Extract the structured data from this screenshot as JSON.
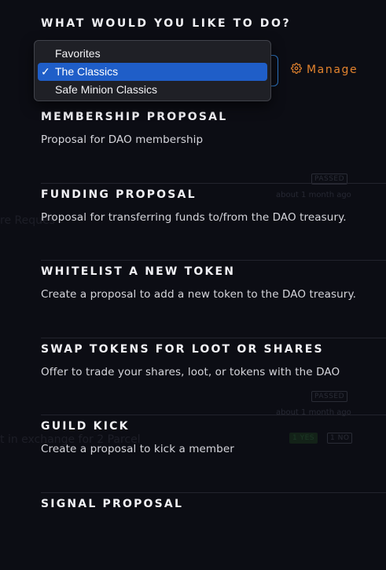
{
  "modal": {
    "heading": "WHAT WOULD YOU LIKE TO DO?",
    "manage_label": "Manage"
  },
  "dropdown": {
    "options": [
      {
        "label": "Favorites",
        "selected": false
      },
      {
        "label": "The Classics",
        "selected": true
      },
      {
        "label": "Safe Minion Classics",
        "selected": false
      }
    ],
    "check_glyph": "✓"
  },
  "proposals": [
    {
      "title": "MEMBERSHIP PROPOSAL",
      "description": "Proposal for DAO membership"
    },
    {
      "title": "FUNDING PROPOSAL",
      "description": "Proposal for transferring funds to/from the DAO treasury."
    },
    {
      "title": "WHITELIST A NEW TOKEN",
      "description": "Create a proposal to add a new token to the DAO treasury."
    },
    {
      "title": "SWAP TOKENS FOR LOOT OR SHARES",
      "description": "Offer to trade your shares, loot, or tokens with the DAO"
    },
    {
      "title": "GUILD KICK",
      "description": "Create a proposal to kick a member"
    },
    {
      "title": "SIGNAL PROPOSAL",
      "description": ""
    }
  ],
  "background": {
    "texts": [
      "re Reques",
      "t in exchange for 2 Parcel"
    ],
    "chips": [
      "PASSED",
      "PASSED",
      "1 YES",
      "1 NO"
    ],
    "subtexts": [
      "about 1 month ago",
      "about 1 month ago"
    ]
  },
  "colors": {
    "accent": "#e3832e",
    "select_highlight": "#1f5ec8",
    "focus_border": "#2f79c7"
  },
  "icons": {
    "manage": "gear-icon"
  }
}
